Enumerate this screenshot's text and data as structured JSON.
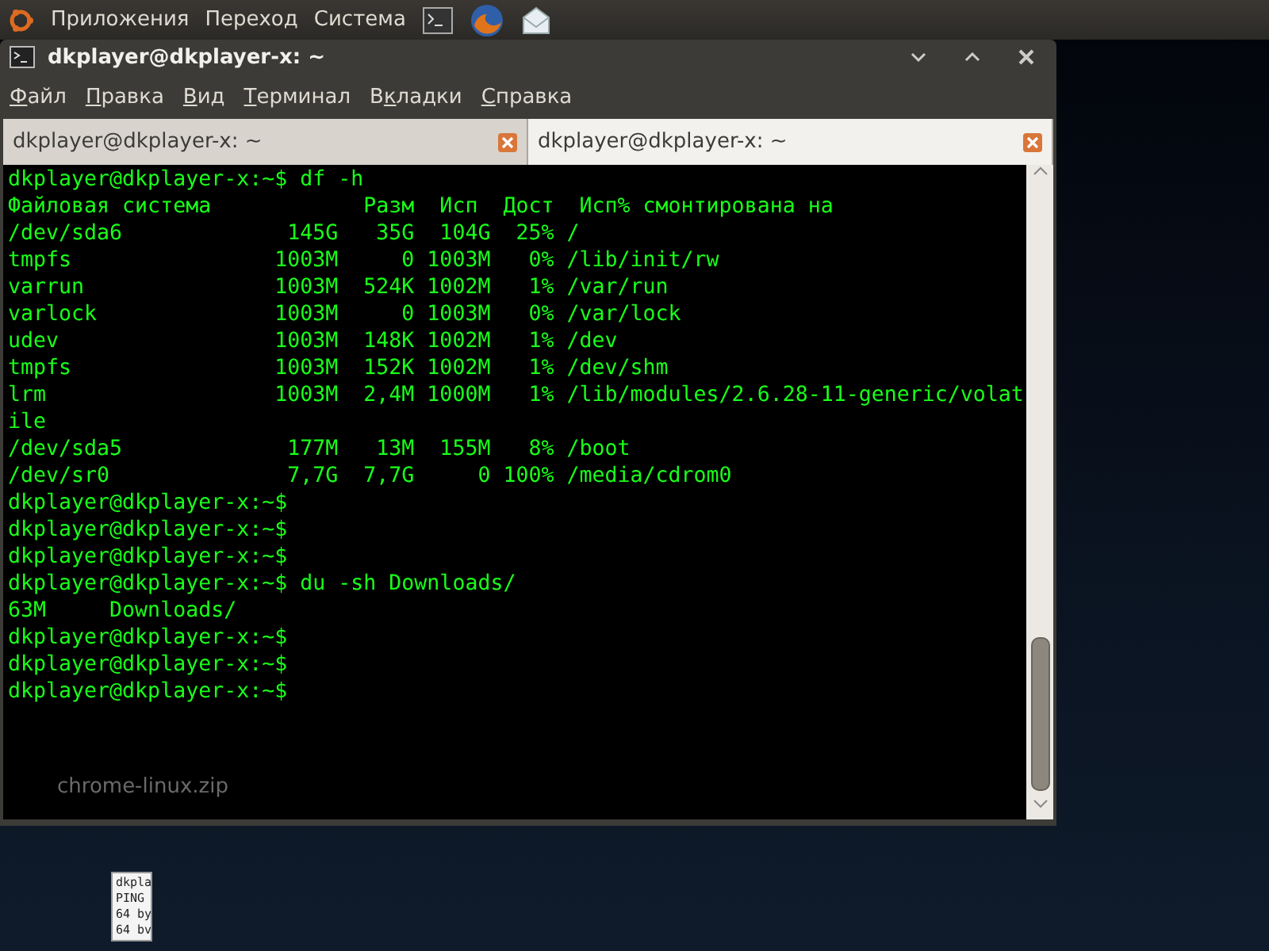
{
  "top_panel": {
    "menus": [
      "Приложения",
      "Переход",
      "Система"
    ]
  },
  "window": {
    "title": "dkplayer@dkplayer-x: ~",
    "menu": [
      {
        "accel": "Ф",
        "after": "айл"
      },
      {
        "accel": "П",
        "after": "равка"
      },
      {
        "accel": "В",
        "after": "ид"
      },
      {
        "accel": "Т",
        "after": "ерминал"
      },
      {
        "before": "В",
        "accel": "к",
        "after": "ладки"
      },
      {
        "accel": "С",
        "after": "правка"
      }
    ],
    "tabs": [
      {
        "label": "dkplayer@dkplayer-x: ~",
        "selected": false
      },
      {
        "label": "dkplayer@dkplayer-x: ~",
        "selected": true
      }
    ],
    "terminal_lines": [
      "dkplayer@dkplayer-x:~$ df -h",
      "Файловая система            Разм  Исп  Дост  Исп% смонтирована на",
      "/dev/sda6             145G   35G  104G  25% /",
      "tmpfs                1003M     0 1003M   0% /lib/init/rw",
      "varrun               1003M  524K 1002M   1% /var/run",
      "varlock              1003M     0 1003M   0% /var/lock",
      "udev                 1003M  148K 1002M   1% /dev",
      "tmpfs                1003M  152K 1002M   1% /dev/shm",
      "lrm                  1003M  2,4M 1000M   1% /lib/modules/2.6.28-11-generic/volat",
      "ile",
      "/dev/sda5             177M   13M  155M   8% /boot",
      "/dev/sr0              7,7G  7,7G     0 100% /media/cdrom0",
      "dkplayer@dkplayer-x:~$",
      "dkplayer@dkplayer-x:~$",
      "dkplayer@dkplayer-x:~$",
      "dkplayer@dkplayer-x:~$ du -sh Downloads/",
      "63M     Downloads/",
      "dkplayer@dkplayer-x:~$",
      "dkplayer@dkplayer-x:~$",
      "dkplayer@dkplayer-x:~$"
    ],
    "ghost_label": "chrome-linux.zip"
  },
  "desktop": {
    "file_preview": [
      "dkpla",
      "PING",
      "64 by",
      "64 bv"
    ]
  }
}
